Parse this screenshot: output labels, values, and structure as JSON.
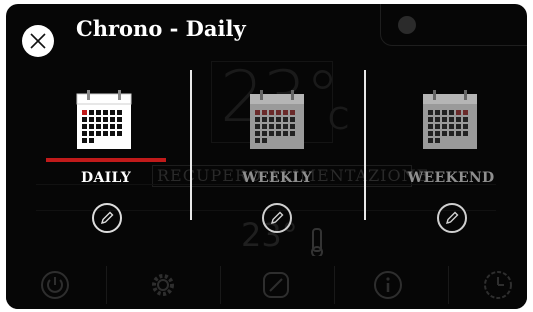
{
  "header": {
    "title": "Chrono - Daily"
  },
  "background": {
    "temperature": "23°",
    "unit": "C",
    "status_text": "RECUPERO ALIMENTAZIONE",
    "external_temperature": "23°"
  },
  "tabs": [
    {
      "label": "DAILY",
      "active": true
    },
    {
      "label": "WEEKLY",
      "active": false
    },
    {
      "label": "WEEKEND",
      "active": false
    }
  ],
  "bottom_bar": {
    "icons": [
      "power-icon",
      "gear-icon",
      "edit-square-icon",
      "info-icon",
      "clock-icon"
    ]
  },
  "colors": {
    "accent": "#c11a1a",
    "background": "#060606",
    "label_active": "#ffffff",
    "label_inactive": "#8f8f8f"
  }
}
